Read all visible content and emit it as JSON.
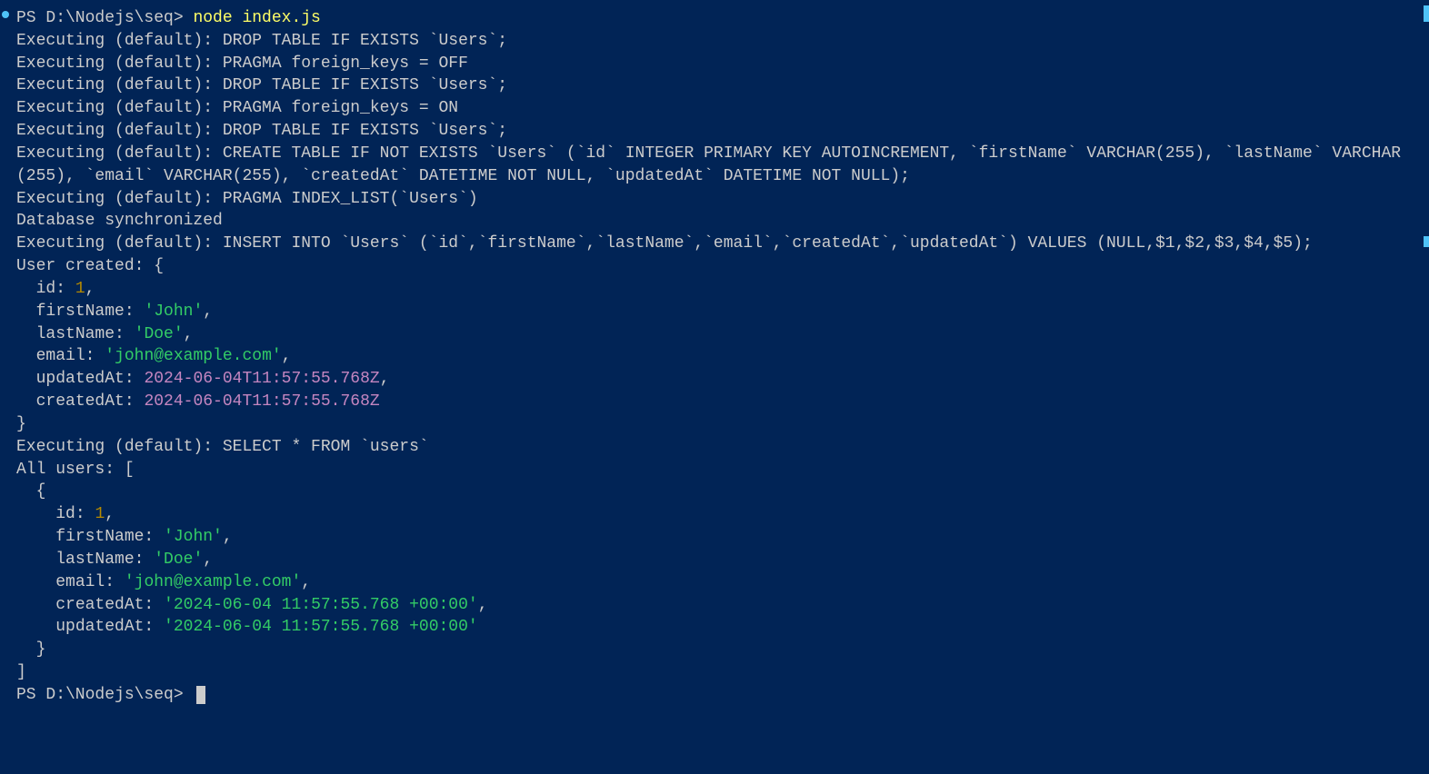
{
  "prompt1": {
    "path": "PS D:\\Nodejs\\seq> ",
    "cmd": "node index.js"
  },
  "lines": {
    "l1": "Executing (default): DROP TABLE IF EXISTS `Users`;",
    "l2": "Executing (default): PRAGMA foreign_keys = OFF",
    "l3": "Executing (default): DROP TABLE IF EXISTS `Users`;",
    "l4": "Executing (default): PRAGMA foreign_keys = ON",
    "l5": "Executing (default): DROP TABLE IF EXISTS `Users`;",
    "l6": "Executing (default): CREATE TABLE IF NOT EXISTS `Users` (`id` INTEGER PRIMARY KEY AUTOINCREMENT, `firstName` VARCHAR(255), `lastName` VARCHAR(255), `email` VARCHAR(255), `createdAt` DATETIME NOT NULL, `updatedAt` DATETIME NOT NULL);",
    "l7": "Executing (default): PRAGMA INDEX_LIST(`Users`)",
    "l8": "Database synchronized",
    "l9": "Executing (default): INSERT INTO `Users` (`id`,`firstName`,`lastName`,`email`,`createdAt`,`updatedAt`) VALUES (NULL,$1,$2,$3,$4,$5);",
    "l10": "User created: {",
    "l11a": "  id: ",
    "l11b": "1",
    "l11c": ",",
    "l12a": "  firstName: ",
    "l12b": "'John'",
    "l12c": ",",
    "l13a": "  lastName: ",
    "l13b": "'Doe'",
    "l13c": ",",
    "l14a": "  email: ",
    "l14b": "'john@example.com'",
    "l14c": ",",
    "l15a": "  updatedAt: ",
    "l15b": "2024-06-04T11:57:55.768Z",
    "l15c": ",",
    "l16a": "  createdAt: ",
    "l16b": "2024-06-04T11:57:55.768Z",
    "l17": "}",
    "l18": "Executing (default): SELECT * FROM `users`",
    "l19": "All users: [",
    "l20": "  {",
    "l21a": "    id: ",
    "l21b": "1",
    "l21c": ",",
    "l22a": "    firstName: ",
    "l22b": "'John'",
    "l22c": ",",
    "l23a": "    lastName: ",
    "l23b": "'Doe'",
    "l23c": ",",
    "l24a": "    email: ",
    "l24b": "'john@example.com'",
    "l24c": ",",
    "l25a": "    createdAt: ",
    "l25b": "'2024-06-04 11:57:55.768 +00:00'",
    "l25c": ",",
    "l26a": "    updatedAt: ",
    "l26b": "'2024-06-04 11:57:55.768 +00:00'",
    "l27": "  }",
    "l28": "]"
  },
  "prompt2": {
    "path": "PS D:\\Nodejs\\seq> "
  }
}
